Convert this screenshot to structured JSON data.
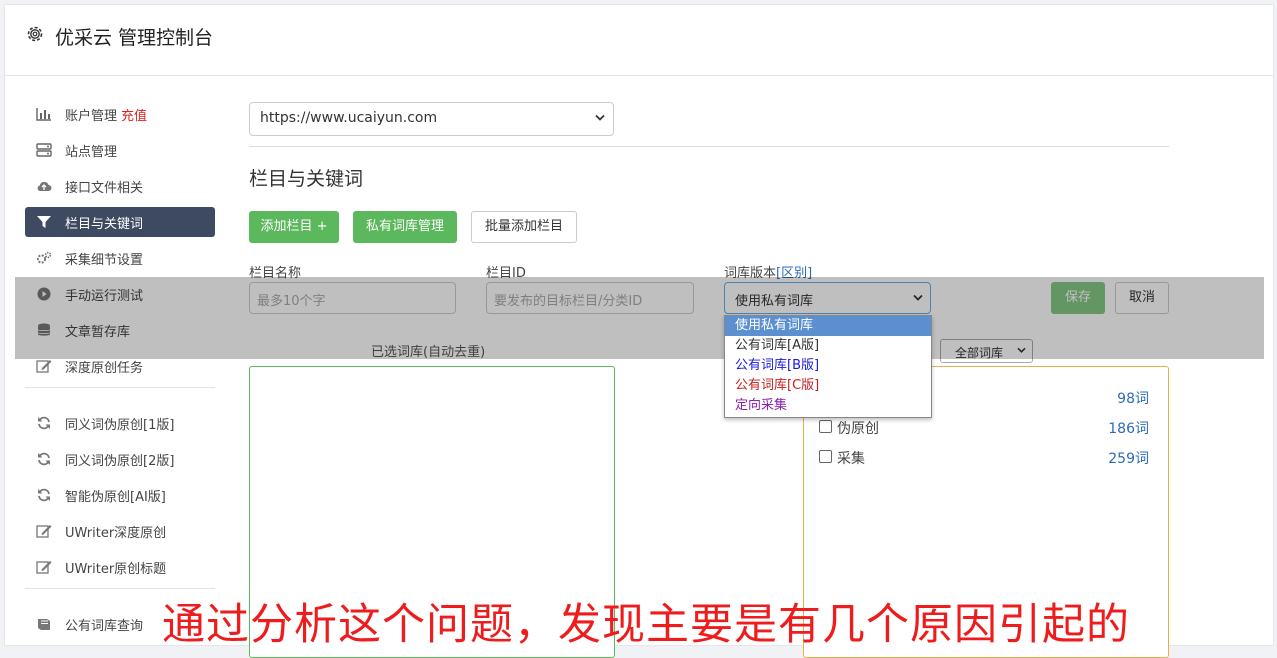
{
  "header": {
    "title": "优采云 管理控制台"
  },
  "sidebar": {
    "items": [
      {
        "label": "账户管理",
        "badge": "充值",
        "icon": "bar-chart-icon"
      },
      {
        "label": "站点管理",
        "icon": "server-icon"
      },
      {
        "label": "接口文件相关",
        "icon": "cloud-upload-icon"
      },
      {
        "label": "栏目与关键词",
        "icon": "filter-icon",
        "active": true
      },
      {
        "label": "采集细节设置",
        "icon": "cogs-icon"
      },
      {
        "label": "手动运行测试",
        "icon": "play-circle-icon"
      },
      {
        "label": "文章暂存库",
        "icon": "database-icon"
      },
      {
        "label": "深度原创任务",
        "icon": "edit-icon"
      },
      {
        "label": "同义词伪原创[1版]",
        "icon": "refresh-icon"
      },
      {
        "label": "同义词伪原创[2版]",
        "icon": "refresh-icon"
      },
      {
        "label": "智能伪原创[AI版]",
        "icon": "refresh-icon"
      },
      {
        "label": "UWriter深度原创",
        "icon": "edit-icon"
      },
      {
        "label": "UWriter原创标题",
        "icon": "edit-icon"
      },
      {
        "label": "公有词库查询",
        "icon": "book-icon"
      }
    ]
  },
  "site_select": {
    "value": "https://www.ucaiyun.com"
  },
  "section_title": "栏目与关键词",
  "toolbar": {
    "add_column": "添加栏目 +",
    "private_lib": "私有词库管理",
    "batch_add": "批量添加栏目"
  },
  "form": {
    "name_label": "栏目名称",
    "name_placeholder": "最多10个字",
    "id_label": "栏目ID",
    "id_placeholder": "要发布的目标栏目/分类ID",
    "version_label": "词库版本",
    "version_link": "[区别]",
    "version_value": "使用私有词库",
    "save": "保存",
    "cancel": "取消"
  },
  "dropdown": {
    "options": [
      {
        "label": "使用私有词库",
        "color": "#ffffff",
        "selected": true
      },
      {
        "label": "公有词库[A版]",
        "color": "#333333"
      },
      {
        "label": "公有词库[B版]",
        "color": "#1a1adb"
      },
      {
        "label": "公有词库[C版]",
        "color": "#c81e1e"
      },
      {
        "label": "定向采集",
        "color": "#8a1fb0"
      }
    ]
  },
  "selected_box_label": "已选词库(自动去重)",
  "lib_filter": {
    "value": "全部词库"
  },
  "libraries": [
    {
      "name": "",
      "count": "98词"
    },
    {
      "name": "伪原创",
      "count": "186词"
    },
    {
      "name": "采集",
      "count": "259词"
    }
  ],
  "caption": "通过分析这个问题，发现主要是有几个原因引起的"
}
